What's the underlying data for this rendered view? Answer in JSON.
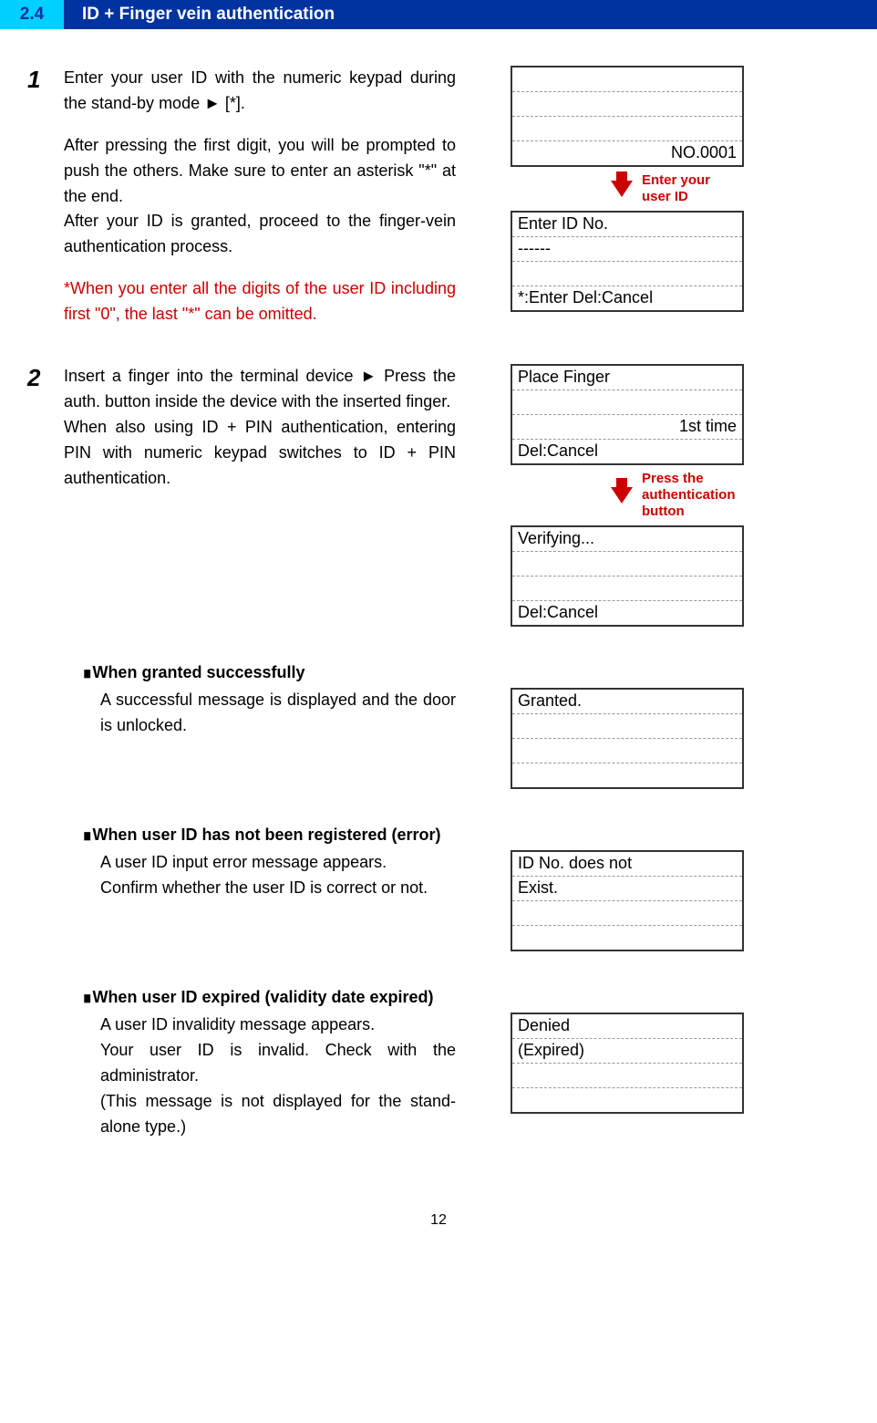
{
  "header": {
    "number": "2.4",
    "title": "ID + Finger vein authentication"
  },
  "step1": {
    "num": "1",
    "para1": "Enter your user ID with the numeric keypad during the stand-by mode ► [*].",
    "para2": "After pressing the first digit, you will be prompted to push the others. Make sure to enter an asterisk \"*\" at the end.",
    "para3": "After your ID is granted, proceed to the finger-vein authentication process.",
    "note": "*When you enter all the digits of the user ID including first \"0\", the last \"*\" can be omitted."
  },
  "display1a": {
    "r1": "",
    "r2": "",
    "r3": "",
    "r4": "NO.0001"
  },
  "arrow1": "Enter your user ID",
  "display1b": {
    "r1": "Enter ID No.",
    "r2": "------",
    "r3": "",
    "r4": "*:Enter Del:Cancel"
  },
  "step2": {
    "num": "2",
    "para1": "Insert a finger into the terminal device ► Press the auth. button inside the device with the inserted finger.",
    "para2": "When also using ID + PIN authentication, entering PIN with numeric keypad switches to ID + PIN authentication."
  },
  "display2a": {
    "r1": "Place Finger",
    "r2": "",
    "r3": "1st time",
    "r4": "Del:Cancel"
  },
  "arrow2a": "Press the",
  "arrow2b": "authentication button",
  "display2b": {
    "r1": "Verifying...",
    "r2": "",
    "r3": "",
    "r4": "Del:Cancel"
  },
  "sub_granted": {
    "head": "∎When granted successfully",
    "body": "A successful message is displayed and the door is unlocked.",
    "disp": {
      "r1": "Granted.",
      "r2": "",
      "r3": "",
      "r4": ""
    }
  },
  "sub_notreg": {
    "head": "∎When user ID has not been registered (error)",
    "body1": "A user ID input error message appears.",
    "body2": "Confirm whether the user ID is correct or not.",
    "disp": {
      "r1": "ID No. does not",
      "r2": "Exist.",
      "r3": "",
      "r4": ""
    }
  },
  "sub_expired": {
    "head": "∎When user ID expired (validity date expired)",
    "body1": "A user ID invalidity message appears.",
    "body2": "Your user ID is invalid. Check with the administrator.",
    "body3": "(This message is not displayed for the stand-alone type.)",
    "disp": {
      "r1": "Denied",
      "r2": "(Expired)",
      "r3": "",
      "r4": ""
    }
  },
  "page_number": "12"
}
